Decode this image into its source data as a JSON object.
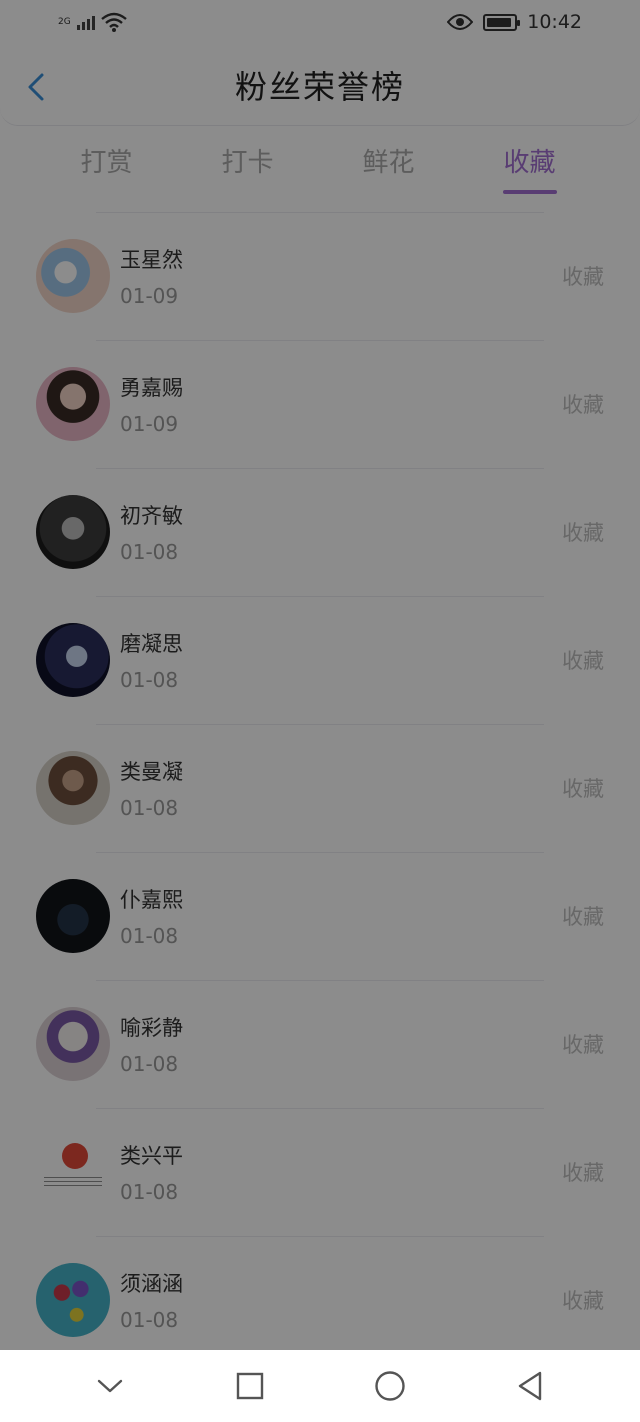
{
  "status_bar": {
    "network": "2G",
    "time": "10:42",
    "battery_level": 0.9
  },
  "header": {
    "title": "粉丝荣誉榜",
    "back_icon": "chevron-left-icon"
  },
  "tabs": [
    {
      "label": "打赏",
      "active": false
    },
    {
      "label": "打卡",
      "active": false
    },
    {
      "label": "鲜花",
      "active": false
    },
    {
      "label": "收藏",
      "active": true
    }
  ],
  "fans": [
    {
      "name": "玉星然",
      "date": "01-09",
      "action": "收藏"
    },
    {
      "name": "勇嘉赐",
      "date": "01-09",
      "action": "收藏"
    },
    {
      "name": "初齐敏",
      "date": "01-08",
      "action": "收藏"
    },
    {
      "name": "磨凝思",
      "date": "01-08",
      "action": "收藏"
    },
    {
      "name": "类曼凝",
      "date": "01-08",
      "action": "收藏"
    },
    {
      "name": "仆嘉熙",
      "date": "01-08",
      "action": "收藏"
    },
    {
      "name": "喻彩静",
      "date": "01-08",
      "action": "收藏"
    },
    {
      "name": "类兴平",
      "date": "01-08",
      "action": "收藏"
    },
    {
      "name": "须涵涵",
      "date": "01-08",
      "action": "收藏"
    }
  ],
  "colors": {
    "accent": "#a36fd2",
    "back_icon": "#3a8fd8"
  },
  "nav": [
    "chevron-down-icon",
    "square-icon",
    "circle-icon",
    "triangle-back-icon"
  ]
}
